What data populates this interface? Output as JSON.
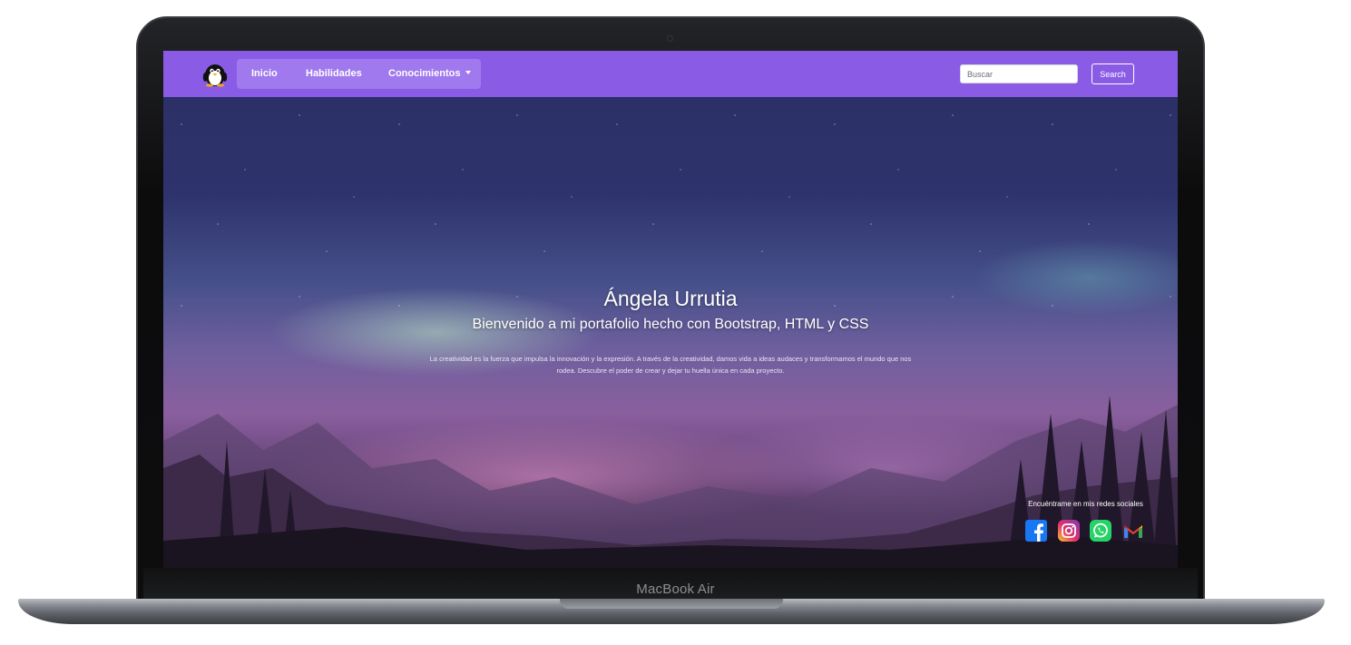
{
  "device": {
    "brand_label": "MacBook Air"
  },
  "navbar": {
    "bg_color": "#8a5ce6",
    "pill_color": "#a079ee",
    "logo_icon": "penguin-icon",
    "links": [
      {
        "label": "Inicio"
      },
      {
        "label": "Habilidades"
      },
      {
        "label": "Conocimientos",
        "dropdown": true
      }
    ],
    "search": {
      "placeholder": "Buscar",
      "value": ""
    },
    "search_button": "Search"
  },
  "hero": {
    "name": "Ángela Urrutia",
    "subtitle": "Bienvenido a mi portafolio hecho con Bootstrap, HTML y CSS",
    "text": "La creatividad es la fuerza que impulsa la innovación y la expresión. A través de la creatividad, damos vida a ideas audaces y transformamos el mundo que nos rodea. Descubre el poder de crear y dejar tu huella única en cada proyecto."
  },
  "socials": {
    "label": "Encuéntrame en mis redes sociales",
    "icons": [
      {
        "name": "facebook-icon",
        "color": "#1877f2"
      },
      {
        "name": "instagram-icon",
        "color": "#e1306c"
      },
      {
        "name": "whatsapp-icon",
        "color": "#25d366"
      },
      {
        "name": "gmail-icon",
        "color": "#ea4335"
      }
    ]
  }
}
